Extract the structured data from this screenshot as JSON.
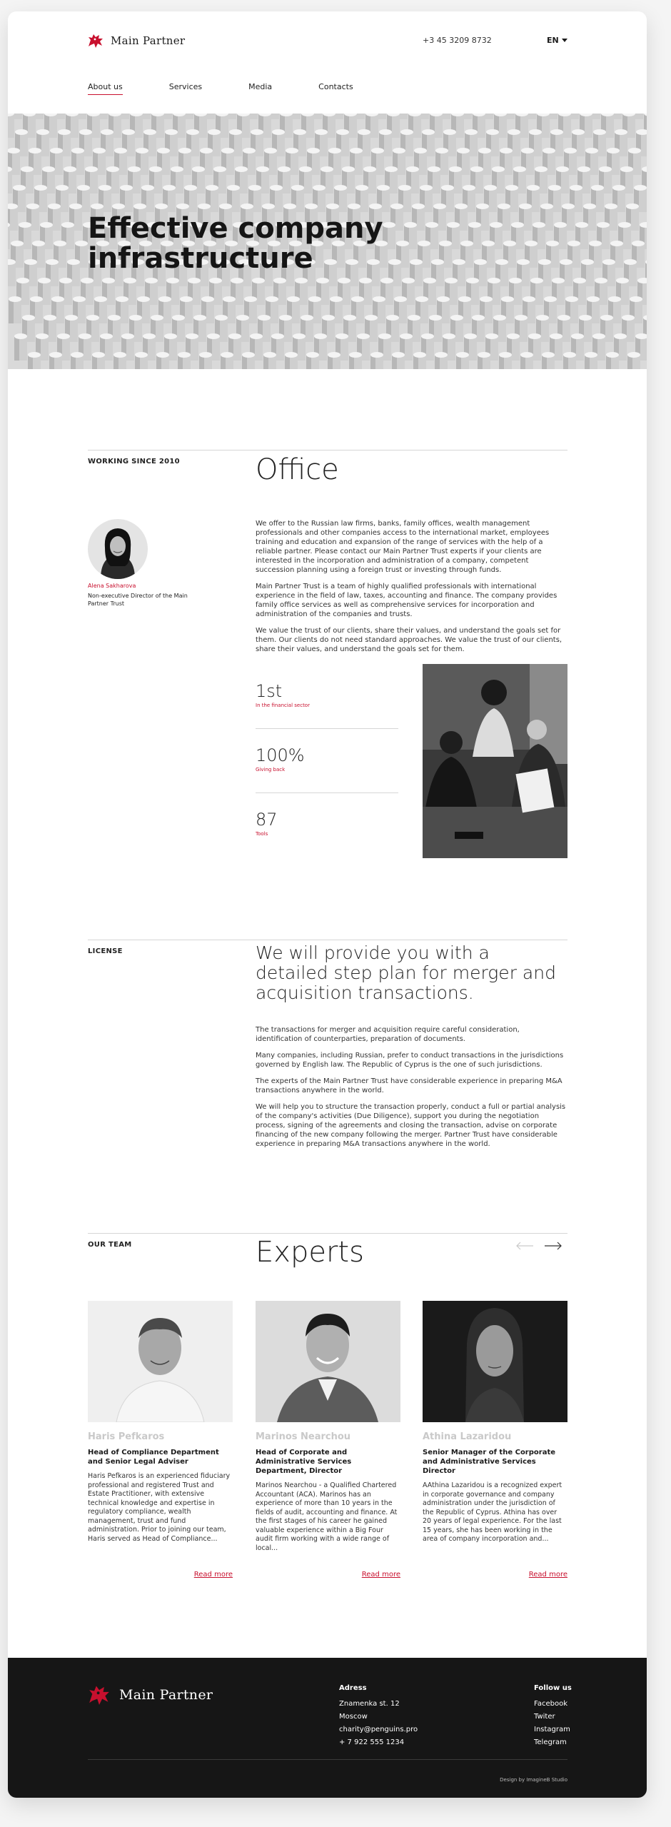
{
  "brand": {
    "name": "Main Partner",
    "accent": "#c8102e"
  },
  "header": {
    "phone": "+3 45 3209 8732",
    "lang": "EN",
    "nav": [
      {
        "label": "About us",
        "active": true
      },
      {
        "label": "Services"
      },
      {
        "label": "Media"
      },
      {
        "label": "Contacts"
      }
    ]
  },
  "hero": {
    "title": "Effective company infrastructure"
  },
  "office": {
    "eyebrow": "WORKING SINCE 2010",
    "title": "Office",
    "paragraphs": [
      "We offer to the Russian law firms, banks, family offices, wealth management professionals and other companies access to the international market, employees training and education and expansion of the range of services with the help of a reliable partner. Please contact our Main Partner Trust experts if your clients are interested in the incorporation and administration of a company, competent succession planning using a foreign trust or investing through funds.",
      "Main Partner Trust is a team of highly qualified professionals with international experience in the field of law, taxes, accounting and finance. The company provides family office services as well as comprehensive services for incorporation and administration of the companies and trusts.",
      "We value the trust of our clients, share their values, and understand the goals set for them. Our clients do not need standard approaches. We value the trust of our clients, share their values, and understand the goals set for them."
    ],
    "person": {
      "name": "Alena Sakharova",
      "role": "Non-executive Director of the Main Partner Trust"
    },
    "stats": [
      {
        "value": "1st",
        "label": "In the financial sector"
      },
      {
        "value": "100%",
        "label": "Giving back"
      },
      {
        "value": "87",
        "label": "Tools"
      }
    ]
  },
  "license": {
    "eyebrow": "LICENSE",
    "title": "We will provide you with a detailed step plan for merger and acquisition transactions.",
    "paragraphs": [
      "The transactions for merger and acquisition require careful consideration, identification of counterparties, preparation of documents.",
      "Many companies, including Russian, prefer to conduct transactions in the jurisdictions governed by English law. The Republic of Cyprus is the one of such jurisdictions.",
      "The experts of the Main Partner Trust have considerable experience in preparing M&A transactions anywhere in the world.",
      "We will help you to structure the transaction properly, conduct a full or partial analysis of the company's activities (Due Diligence), support you during the negotiation process, signing of the agreements and closing the transaction, advise on corporate financing of the new company following the merger. Partner Trust have considerable experience in preparing M&A transactions anywhere in the world."
    ]
  },
  "team": {
    "eyebrow": "OUR TEAM",
    "title": "Experts",
    "read_more": "Read more",
    "members": [
      {
        "name": "Haris Pefkaros",
        "title": "Head of Compliance Department and Senior Legal Adviser",
        "bio": "Haris Pefkaros is an experienced fiduciary professional and registered Trust and Estate Practitioner, with extensive technical knowledge and expertise in regulatory compliance, wealth management, trust and fund administration. Prior to joining our team, Haris served as Head of Compliance..."
      },
      {
        "name": "Marinos Nearchou",
        "title": "Head of Corporate and Administrative Services Department, Director",
        "bio": "Marinos Nearchou - a Qualified Chartered Accountant (ACA). Marinos has an experience of more than 10 years in the fields of audit, accounting and finance. At the first stages of his career he gained valuable experience within a Big Four audit firm working with a wide range of local..."
      },
      {
        "name": "Athina Lazaridou",
        "title": "Senior Manager of the Corporate and Administrative Services Director",
        "bio": "AAthina Lazaridou is a recognized expert in corporate governance and company administration under the jurisdiction of the Republic of Cyprus. Athina has over 20 years of legal experience. For the last 15 years, she has been working in the area of company incorporation and..."
      }
    ]
  },
  "footer": {
    "address_heading": "Adress",
    "address_lines": [
      "Znamenka st. 12",
      "Moscow"
    ],
    "email": "charity@penguins.pro",
    "phone": "+ 7 922 555 1234",
    "follow_heading": "Follow us",
    "social": [
      "Facebook",
      "Twiter",
      "Instagram",
      "Telegram"
    ],
    "credit": "Design by ImagineB Studio"
  }
}
